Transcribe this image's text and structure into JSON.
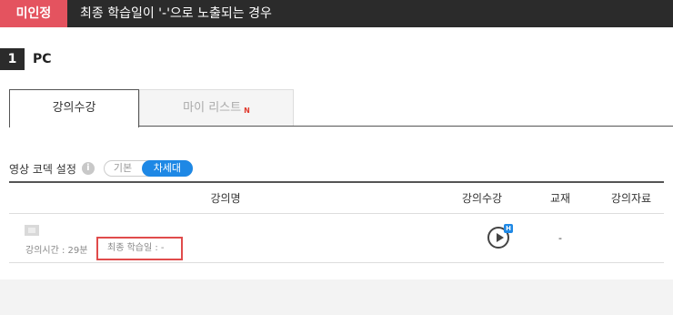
{
  "header": {
    "badge": "미인정",
    "title": "최종 학습일이 '-'으로 노출되는 경우"
  },
  "section": {
    "number": "1",
    "label": "PC"
  },
  "tabs": [
    {
      "label": "강의수강",
      "active": true
    },
    {
      "label": "마이 리스트",
      "new_mark": "N",
      "active": false
    }
  ],
  "codec": {
    "label": "영상 코덱 설정",
    "info_icon": "info-icon",
    "options": [
      "기본",
      "차세대"
    ],
    "selected": "차세대"
  },
  "table": {
    "headers": [
      "강의명",
      "강의수강",
      "교재",
      "강의자료"
    ],
    "rows": [
      {
        "lecture_time": "강의시간 : 29분",
        "last_study": "최종 학습일 : -",
        "play_icon": "play-circle-icon",
        "play_badge": "H",
        "book": "-",
        "material": ""
      }
    ]
  },
  "colors": {
    "badge_bg": "#e4535f",
    "topbar_bg": "#2b2b2b",
    "accent_blue": "#1e88e5",
    "highlight_red": "#e04b4b"
  }
}
